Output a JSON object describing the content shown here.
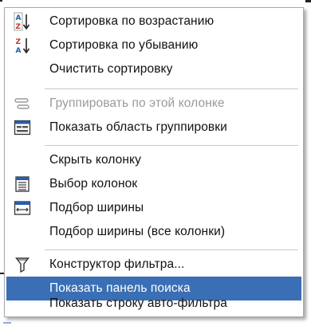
{
  "menu": {
    "items": [
      {
        "label": "Сортировка по возрастанию",
        "icon": "sort-ascending-icon",
        "enabled": true
      },
      {
        "label": "Сортировка по убыванию",
        "icon": "sort-descending-icon",
        "enabled": true
      },
      {
        "label": "Очистить сортировку",
        "icon": "",
        "enabled": true
      },
      {
        "label": "Группировать по этой колонке",
        "icon": "group-by-column-icon",
        "enabled": false
      },
      {
        "label": "Показать область группировки",
        "icon": "group-panel-icon",
        "enabled": true
      },
      {
        "label": "Скрыть колонку",
        "icon": "",
        "enabled": true
      },
      {
        "label": "Выбор колонок",
        "icon": "column-chooser-icon",
        "enabled": true
      },
      {
        "label": "Подбор ширины",
        "icon": "best-fit-icon",
        "enabled": true
      },
      {
        "label": "Подбор ширины (все колонки)",
        "icon": "",
        "enabled": true
      },
      {
        "label": "Конструктор фильтра...",
        "icon": "filter-icon",
        "enabled": true
      },
      {
        "label": "Показать панель поиска",
        "icon": "",
        "enabled": true,
        "highlighted": true
      },
      {
        "label": "Показать строку авто-фильтра",
        "icon": "",
        "enabled": true
      }
    ]
  },
  "colors": {
    "highlight": "#3a6fb5",
    "disabled_text": "#9a9a9a",
    "accent_red": "#c0392b",
    "accent_blue": "#2a5ca8"
  }
}
